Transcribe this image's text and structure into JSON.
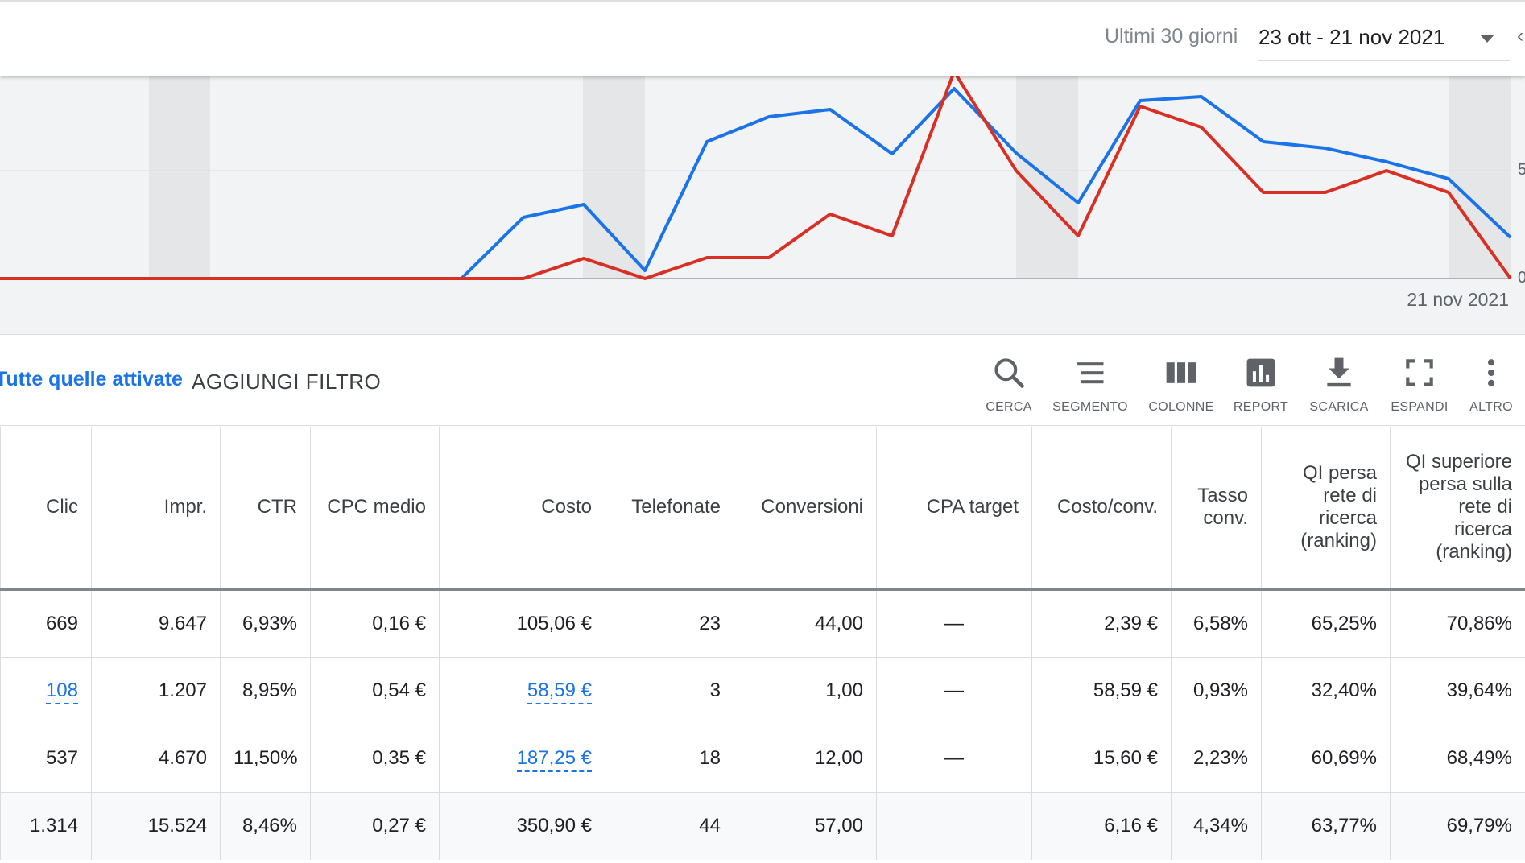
{
  "date_range": {
    "preset": "Ultimi 30 giorni",
    "value": "23 ott - 21 nov 2021"
  },
  "chart": {
    "end_label": "21 nov 2021",
    "axis_ticks": [
      "5",
      "0"
    ],
    "colors": {
      "series_blue": "#1a73e8",
      "series_red": "#d93025"
    }
  },
  "filters": {
    "active_label": "Tutte quelle attivate",
    "add_filter_label": "AGGIUNGI FILTRO"
  },
  "toolbar": [
    {
      "id": "cerca",
      "label": "CERCA",
      "icon": "search-icon"
    },
    {
      "id": "segmento",
      "label": "SEGMENTO",
      "icon": "segment-icon"
    },
    {
      "id": "colonne",
      "label": "COLONNE",
      "icon": "columns-icon"
    },
    {
      "id": "report",
      "label": "REPORT",
      "icon": "report-icon"
    },
    {
      "id": "scarica",
      "label": "SCARICA",
      "icon": "download-icon"
    },
    {
      "id": "espandi",
      "label": "ESPANDI",
      "icon": "fullscreen-icon"
    },
    {
      "id": "altro",
      "label": "ALTRO",
      "icon": "more-vert-icon"
    }
  ],
  "table": {
    "headers": [
      "Clic",
      "Impr.",
      "CTR",
      "CPC medio",
      "Costo",
      "Telefonate",
      "Conversioni",
      "CPA target",
      "Costo/conv.",
      "Tasso conv.",
      "QI persa rete di ricerca (ranking)",
      "QI superiore persa sulla rete di ricerca (ranking)"
    ],
    "rows": [
      [
        "669",
        "9.647",
        "6,93%",
        "0,16 €",
        "105,06 €",
        "23",
        "44,00",
        "—",
        "2,39 €",
        "6,58%",
        "65,25%",
        "70,86%"
      ],
      [
        "108",
        "1.207",
        "8,95%",
        "0,54 €",
        "58,59 €",
        "3",
        "1,00",
        "—",
        "58,59 €",
        "0,93%",
        "32,40%",
        "39,64%"
      ],
      [
        "537",
        "4.670",
        "11,50%",
        "0,35 €",
        "187,25 €",
        "18",
        "12,00",
        "—",
        "15,60 €",
        "2,23%",
        "60,69%",
        "68,49%"
      ]
    ],
    "total": [
      "1.314",
      "15.524",
      "8,46%",
      "0,27 €",
      "350,90 €",
      "44",
      "57,00",
      "",
      "6,16 €",
      "4,34%",
      "63,77%",
      "69,79%"
    ]
  }
}
